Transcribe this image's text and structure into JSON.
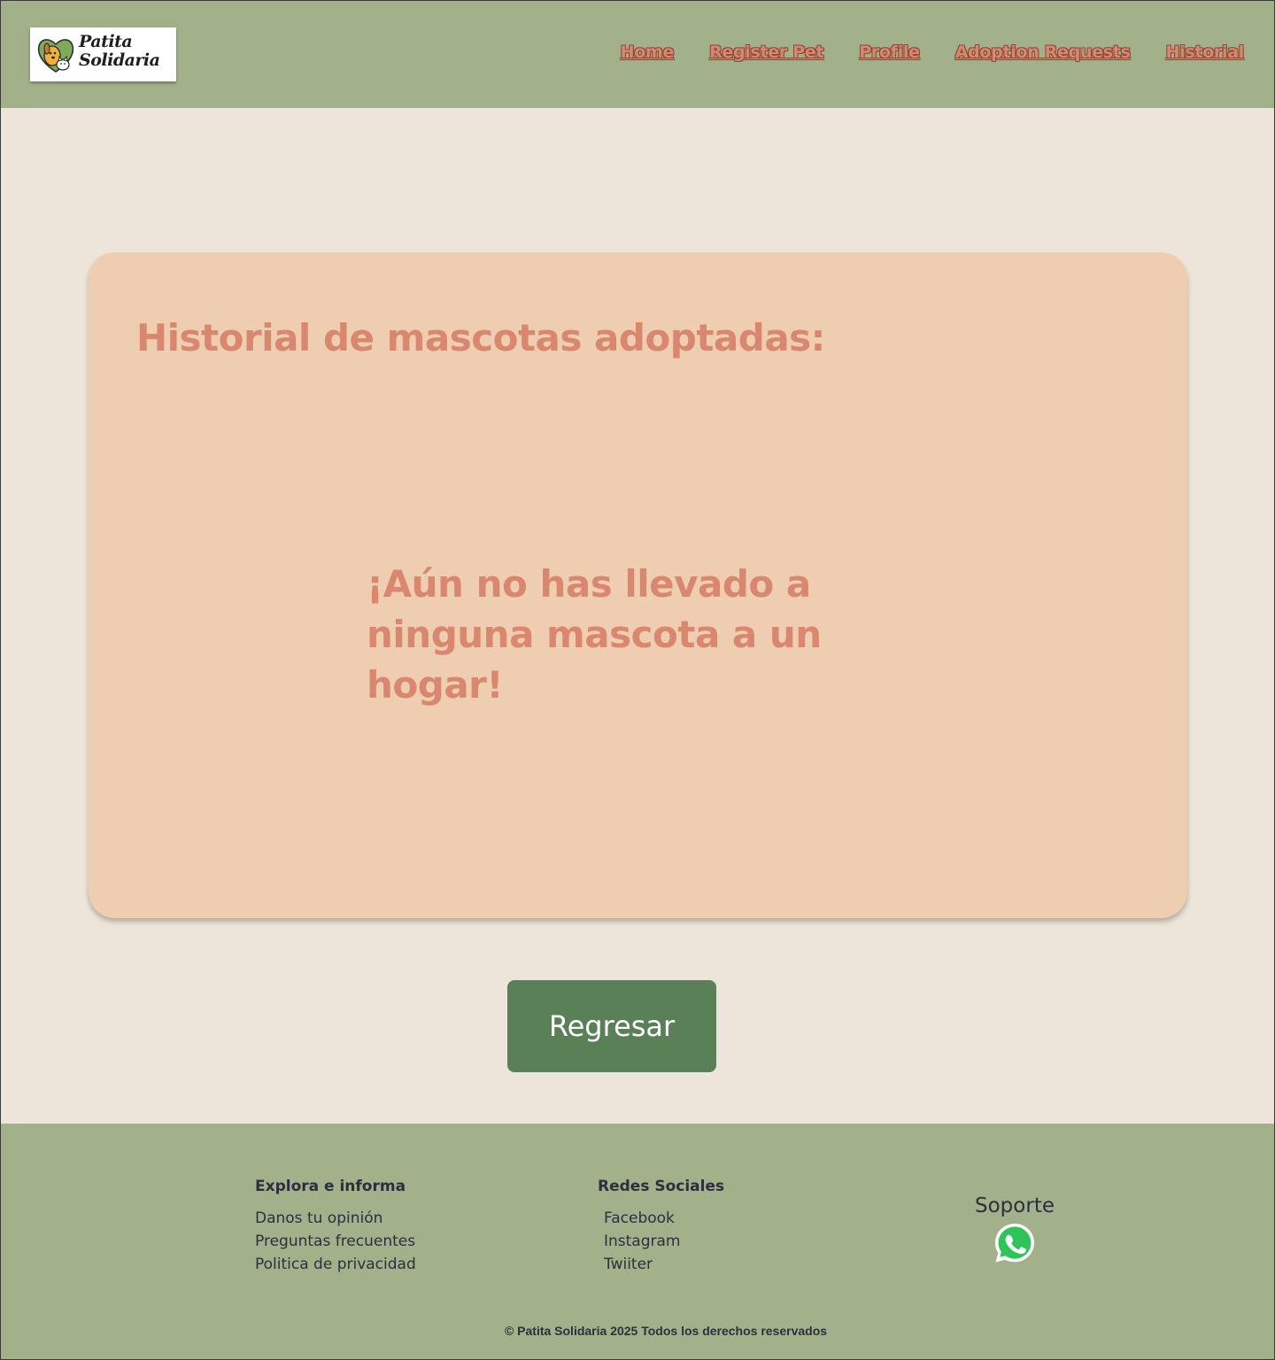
{
  "brand": {
    "logo_line1": "Patita",
    "logo_line2": "Solidaria"
  },
  "nav": {
    "items": [
      {
        "label": "Home",
        "name": "nav-home"
      },
      {
        "label": "Register Pet",
        "name": "nav-register-pet"
      },
      {
        "label": "Profile",
        "name": "nav-profile"
      },
      {
        "label": "Adoption Requests",
        "name": "nav-adoption-requests"
      },
      {
        "label": "Historial",
        "name": "nav-historial"
      }
    ]
  },
  "main": {
    "title": "Historial de mascotas adoptadas:",
    "empty_message": "¡Aún no has llevado a ninguna mascota a un hogar!",
    "back_button": "Regresar"
  },
  "footer": {
    "explore": {
      "heading": "Explora e informa",
      "links": [
        "Danos tu opinión",
        "Preguntas frecuentes",
        "Politica de privacidad"
      ]
    },
    "social": {
      "heading": "Redes Sociales",
      "links": [
        "Facebook",
        "Instagram",
        "Twiiter"
      ]
    },
    "support": {
      "heading": "Soporte",
      "icon": "whatsapp-icon"
    },
    "copyright": "© Patita Solidaria 2025 Todos los derechos reservados"
  },
  "colors": {
    "header_bg": "#a2b18a",
    "page_bg": "#ede5da",
    "card_bg": "#eecdb0",
    "accent_text": "#d9876e",
    "button_bg": "#5a8058"
  }
}
